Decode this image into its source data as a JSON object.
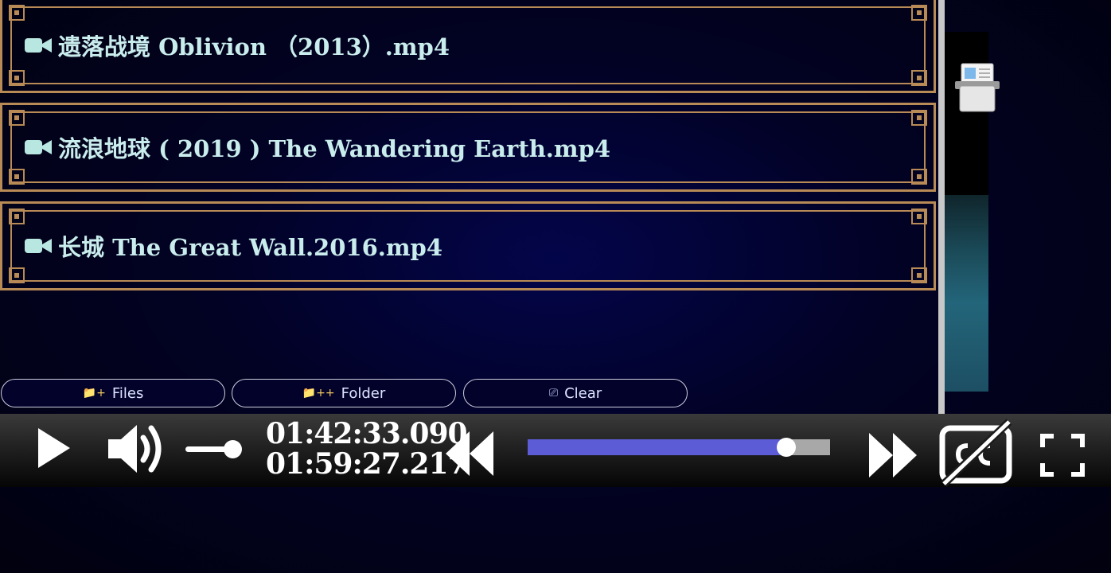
{
  "playlist": {
    "items": [
      {
        "icon": "video-camera-icon",
        "label": "遗落战境 Oblivion （2013）.mp4"
      },
      {
        "icon": "video-camera-icon",
        "label": "流浪地球 ( 2019 ) The Wandering Earth.mp4"
      },
      {
        "icon": "video-camera-icon",
        "label": "长城 The Great Wall.2016.mp4"
      }
    ]
  },
  "buttons": {
    "files": {
      "icon": "📁+",
      "label": "Files"
    },
    "folder": {
      "icon": "📁++",
      "label": "Folder"
    },
    "clear": {
      "icon": "⎚",
      "label": "Clear"
    }
  },
  "player": {
    "current_time": "01:42:33.090",
    "duration": "01:59:27.217",
    "progress_fraction": 0.856,
    "volume_fraction": 0.8
  },
  "colors": {
    "frame": "#b88a55",
    "title_text": "#c9ecec",
    "progress_fill": "#5c5cd6",
    "progress_track": "#a8a8a8"
  }
}
